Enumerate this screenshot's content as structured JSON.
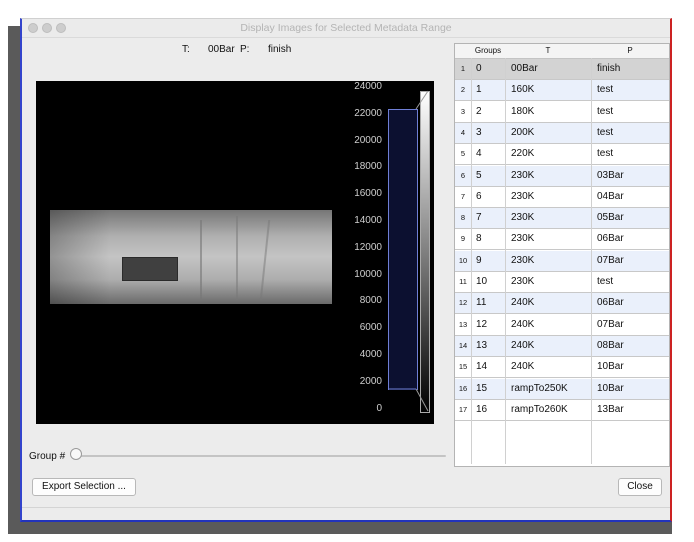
{
  "window": {
    "title": "Display Images for Selected Metadata Range"
  },
  "header": {
    "t_label": "T:",
    "t_value": "00Bar",
    "p_label": "P:",
    "p_value": "finish"
  },
  "colorbar": {
    "ticks": [
      "24000",
      "22000",
      "20000",
      "18000",
      "16000",
      "14000",
      "12000",
      "10000",
      "8000",
      "6000",
      "4000",
      "2000",
      "0"
    ]
  },
  "controls": {
    "group_label": "Group #",
    "slider_value": 0,
    "export_label": "Export Selection ...",
    "close_label": "Close"
  },
  "table": {
    "headers": [
      "Groups",
      "T",
      "P"
    ],
    "rows": [
      {
        "n": "1",
        "group": "0",
        "t": "00Bar",
        "p": "finish"
      },
      {
        "n": "2",
        "group": "1",
        "t": "160K",
        "p": "test"
      },
      {
        "n": "3",
        "group": "2",
        "t": "180K",
        "p": "test"
      },
      {
        "n": "4",
        "group": "3",
        "t": "200K",
        "p": "test"
      },
      {
        "n": "5",
        "group": "4",
        "t": "220K",
        "p": "test"
      },
      {
        "n": "6",
        "group": "5",
        "t": "230K",
        "p": "03Bar"
      },
      {
        "n": "7",
        "group": "6",
        "t": "230K",
        "p": "04Bar"
      },
      {
        "n": "8",
        "group": "7",
        "t": "230K",
        "p": "05Bar"
      },
      {
        "n": "9",
        "group": "8",
        "t": "230K",
        "p": "06Bar"
      },
      {
        "n": "10",
        "group": "9",
        "t": "230K",
        "p": "07Bar"
      },
      {
        "n": "11",
        "group": "10",
        "t": "230K",
        "p": "test"
      },
      {
        "n": "12",
        "group": "11",
        "t": "240K",
        "p": "06Bar"
      },
      {
        "n": "13",
        "group": "12",
        "t": "240K",
        "p": "07Bar"
      },
      {
        "n": "14",
        "group": "13",
        "t": "240K",
        "p": "08Bar"
      },
      {
        "n": "15",
        "group": "14",
        "t": "240K",
        "p": "10Bar"
      },
      {
        "n": "16",
        "group": "15",
        "t": "rampTo250K",
        "p": "10Bar"
      },
      {
        "n": "17",
        "group": "16",
        "t": "rampTo260K",
        "p": "13Bar"
      }
    ]
  }
}
